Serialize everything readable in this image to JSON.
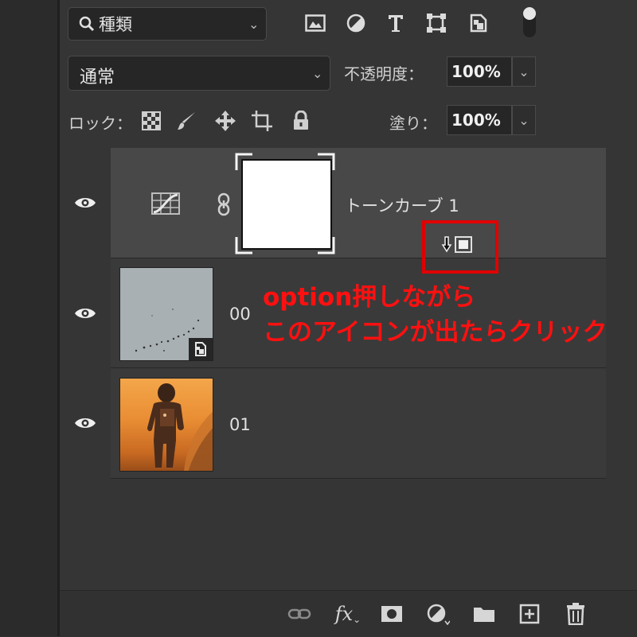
{
  "filter": {
    "kind_label": "種類"
  },
  "blend": {
    "mode": "通常",
    "opacity_label": "不透明度：",
    "opacity_value": "100%"
  },
  "lock": {
    "label": "ロック：",
    "fill_label": "塗り：",
    "fill_value": "100%"
  },
  "layers": [
    {
      "name": "トーンカーブ 1"
    },
    {
      "name": "00"
    },
    {
      "name": "01"
    }
  ],
  "annotation": {
    "line1": "option押しながら",
    "line2": "このアイコンが出たらクリック"
  },
  "colors": {
    "annotation": "#ff1010",
    "panel": "#353535",
    "selected_row": "#484848"
  }
}
